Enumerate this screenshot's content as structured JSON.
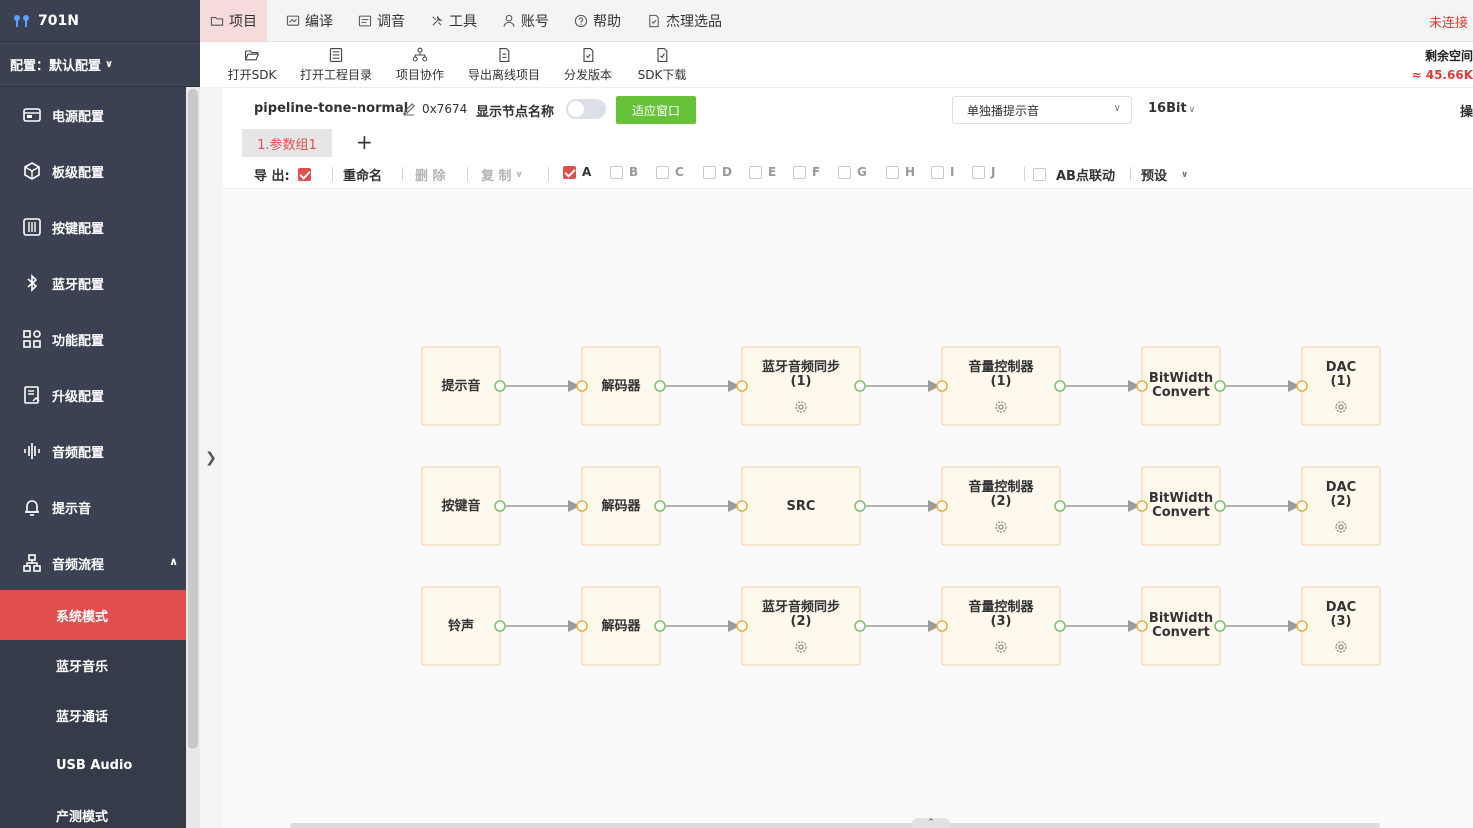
{
  "app": {
    "device_name": "701N",
    "connection_status": "未连接"
  },
  "config": {
    "label": "配置：默认配置"
  },
  "sidebar": {
    "items": [
      {
        "label": "电源配置",
        "icon": "battery-icon"
      },
      {
        "label": "板级配置",
        "icon": "cube-icon"
      },
      {
        "label": "按键配置",
        "icon": "sliders-icon"
      },
      {
        "label": "蓝牙配置",
        "icon": "bluetooth-icon"
      },
      {
        "label": "功能配置",
        "icon": "grid-icon"
      },
      {
        "label": "升级配置",
        "icon": "upgrade-icon"
      },
      {
        "label": "音频配置",
        "icon": "waveform-icon"
      },
      {
        "label": "提示音",
        "icon": "bell-icon"
      },
      {
        "label": "音频流程",
        "icon": "flow-icon",
        "expanded": true
      }
    ],
    "sub_items": [
      {
        "label": "系统模式",
        "active": true
      },
      {
        "label": "蓝牙音乐",
        "active": false
      },
      {
        "label": "蓝牙通话",
        "active": false
      },
      {
        "label": "USB Audio",
        "active": false
      },
      {
        "label": "产测模式",
        "active": false
      }
    ]
  },
  "top_menu": [
    {
      "label": "项目",
      "icon": "folder-icon",
      "active": true
    },
    {
      "label": "编译",
      "icon": "compile-icon",
      "active": false
    },
    {
      "label": "调音",
      "icon": "tuning-icon",
      "active": false
    },
    {
      "label": "工具",
      "icon": "tools-icon",
      "active": false
    },
    {
      "label": "账号",
      "icon": "user-icon",
      "active": false
    },
    {
      "label": "帮助",
      "icon": "help-icon",
      "active": false
    },
    {
      "label": "杰理选品",
      "icon": "catalog-icon",
      "active": false
    }
  ],
  "toolbar": {
    "buttons": [
      {
        "label": "打开SDK",
        "icon": "folder-open-icon"
      },
      {
        "label": "打开工程目录",
        "icon": "list-icon"
      },
      {
        "label": "项目协作",
        "icon": "network-icon"
      },
      {
        "label": "导出离线项目",
        "icon": "export-icon"
      },
      {
        "label": "分发版本",
        "icon": "distribute-icon"
      },
      {
        "label": "SDK下载",
        "icon": "download-icon"
      }
    ],
    "space_label": "剩余空间",
    "space_value": "≈ 45.66K"
  },
  "pipeline": {
    "name": "pipeline-tone-normal",
    "id": "0x7674",
    "show_names_label": "显示节点名称",
    "show_names_on": false,
    "fit_button": "适应窗口",
    "mode": "单独播提示音",
    "bit_depth": "16Bit",
    "edge_text": "操"
  },
  "tabs": {
    "items": [
      "1.参数组1"
    ],
    "add": "+"
  },
  "options": {
    "export_label": "导 出:",
    "export_checked": true,
    "rename": "重命名",
    "delete": "删 除",
    "copy": "复 制",
    "letters": [
      {
        "label": "A",
        "checked": true
      },
      {
        "label": "B",
        "checked": false
      },
      {
        "label": "C",
        "checked": false
      },
      {
        "label": "D",
        "checked": false
      },
      {
        "label": "E",
        "checked": false
      },
      {
        "label": "F",
        "checked": false
      },
      {
        "label": "G",
        "checked": false
      },
      {
        "label": "H",
        "checked": false
      },
      {
        "label": "I",
        "checked": false
      },
      {
        "label": "J",
        "checked": false
      }
    ],
    "ab_link": "AB点联动",
    "ab_link_checked": false,
    "preset": "预设"
  },
  "flow": {
    "rows": [
      [
        {
          "line1": "提示音",
          "line2": "",
          "settings": false
        },
        {
          "line1": "解码器",
          "line2": "",
          "settings": false
        },
        {
          "line1": "蓝牙音频同步",
          "line2": "(1)",
          "settings": true
        },
        {
          "line1": "音量控制器",
          "line2": "(1)",
          "settings": true
        },
        {
          "line1": "BitWidth",
          "line2": "Convert",
          "settings": false
        },
        {
          "line1": "DAC",
          "line2": "(1)",
          "settings": true
        }
      ],
      [
        {
          "line1": "按键音",
          "line2": "",
          "settings": false
        },
        {
          "line1": "解码器",
          "line2": "",
          "settings": false
        },
        {
          "line1": "SRC",
          "line2": "",
          "settings": false
        },
        {
          "line1": "音量控制器",
          "line2": "(2)",
          "settings": true
        },
        {
          "line1": "BitWidth",
          "line2": "Convert",
          "settings": false
        },
        {
          "line1": "DAC",
          "line2": "(2)",
          "settings": true
        }
      ],
      [
        {
          "line1": "铃声",
          "line2": "",
          "settings": false
        },
        {
          "line1": "解码器",
          "line2": "",
          "settings": false
        },
        {
          "line1": "蓝牙音频同步",
          "line2": "(2)",
          "settings": true
        },
        {
          "line1": "音量控制器",
          "line2": "(3)",
          "settings": true
        },
        {
          "line1": "BitWidth",
          "line2": "Convert",
          "settings": false
        },
        {
          "line1": "DAC",
          "line2": "(3)",
          "settings": true
        }
      ]
    ]
  },
  "colors": {
    "accent": "#e04e4e",
    "sidebar_bg": "#3b4151",
    "node_fill": "#fff8ec",
    "node_border": "#f0cfa0",
    "port_out": "#7cc26a",
    "port_in": "#f0b040",
    "fit_button": "#67c23a"
  }
}
